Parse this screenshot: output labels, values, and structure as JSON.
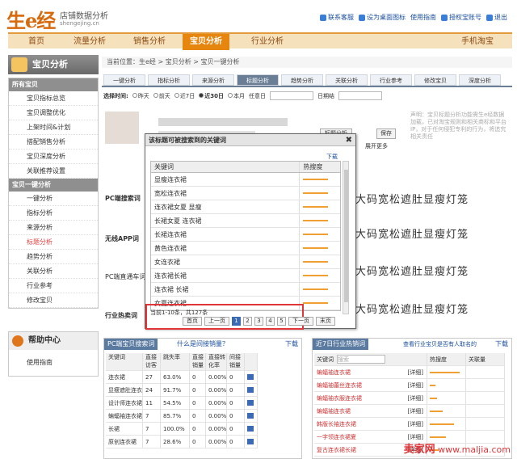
{
  "logo": {
    "text": "生e经",
    "subtitle": "店铺数据分析",
    "domain": "shengejing.cn"
  },
  "toplinks": [
    "联系客服",
    "设为桌面图标",
    "使用指南",
    "授权宝账号",
    "退出"
  ],
  "nav": {
    "tabs": [
      "首页",
      "流量分析",
      "销售分析",
      "宝贝分析",
      "行业分析"
    ],
    "right": "手机淘宝",
    "active": 3
  },
  "sidebar": {
    "title": "宝贝分析",
    "group1": {
      "head": "所有宝贝",
      "items": [
        "宝贝指标总览",
        "宝贝调整优化",
        "上架时间&计划",
        "搭配销售分析",
        "宝贝深度分析",
        "关联推荐设置"
      ]
    },
    "group2": {
      "head": "宝贝一键分析",
      "items": [
        "一键分析",
        "指标分析",
        "来源分析",
        "标题分析",
        "趋势分析",
        "关联分析",
        "行业参考",
        "修改宝贝"
      ]
    }
  },
  "help": {
    "title": "帮助中心",
    "item": "使用指南"
  },
  "breadcrumb": "当前位置：生e经 > 宝贝分析 > 宝贝一键分析",
  "subtabs": [
    "一键分析",
    "指标分析",
    "来源分析",
    "标题分析",
    "趋势分析",
    "关联分析",
    "行业参考",
    "修改宝贝",
    "深度分析"
  ],
  "timebar": {
    "label": "选择时间:",
    "options": [
      "昨天",
      "前天",
      "近7日",
      "近30日",
      "本月"
    ],
    "any": "任意日",
    "to": "日期结"
  },
  "declare": "声明：宝贝标题分析功能​需生e经数据加载，已对​淘宝规则和相关商标和​平台IP，对于任何侵犯专利​的行为，将追究相关责任",
  "buttons": {
    "analyze": "标题分析",
    "save": "保存",
    "expand": "展开更多"
  },
  "rows": [
    {
      "label": "PC端搜索词",
      "text": "大码宽松遮肚显瘦灯笼"
    },
    {
      "label": "无线APP词",
      "text": "大码宽松遮肚显瘦灯笼"
    },
    {
      "label": "PC端直通车词",
      "text": "大码宽松遮肚显瘦灯笼"
    },
    {
      "label": "行业热卖词",
      "text": "大码宽松遮肚显瘦灯笼"
    }
  ],
  "modal": {
    "title": "该标题可被搜索到的关键词",
    "download": "下载",
    "col1": "关键词",
    "col2": "热搜度",
    "rows": [
      {
        "k": "显瘦连衣裙",
        "v": 0.85
      },
      {
        "k": "宽松连衣裙",
        "v": 0.85
      },
      {
        "k": "连衣裙女夏 显瘦",
        "v": 0.85
      },
      {
        "k": "长裙女夏 连衣裙",
        "v": 0.85
      },
      {
        "k": "长裙连衣裙",
        "v": 0.85
      },
      {
        "k": "黄色连衣裙",
        "v": 0.85
      },
      {
        "k": "女连衣裙",
        "v": 0.85
      },
      {
        "k": "连衣裙长裙",
        "v": 0.85
      },
      {
        "k": "连衣裙 长裙",
        "v": 0.85
      },
      {
        "k": "女夏连衣裙",
        "v": 0.85
      }
    ],
    "summary": "当前1-10条，共127条",
    "pager": {
      "first": "首页",
      "prev": "上一页",
      "pages": [
        "1",
        "2",
        "3",
        "4",
        "5"
      ],
      "next": "下一页",
      "last": "末页"
    }
  },
  "left_table": {
    "tag": "PC端宝贝搜索词",
    "link": "什么是间接销量？",
    "download": "下载",
    "headers": [
      "关键词",
      "直接访客",
      "跳失率",
      "直接销量",
      "直接转化率",
      "间接销量"
    ],
    "rows": [
      [
        "连衣裙",
        "27",
        "63.0%",
        "0",
        "0.00%",
        "0"
      ],
      [
        "显瘦遮肚连衣裙",
        "24",
        "91.7%",
        "0",
        "0.00%",
        "0"
      ],
      [
        "设计师连衣裙",
        "11",
        "54.5%",
        "0",
        "0.00%",
        "0"
      ],
      [
        "蝙蝠袖连衣裙",
        "7",
        "85.7%",
        "0",
        "0.00%",
        "0"
      ],
      [
        "长裙",
        "7",
        "100.0%",
        "0",
        "0.00%",
        "0"
      ],
      [
        "原创连衣裙",
        "7",
        "28.6%",
        "0",
        "0.00%",
        "0"
      ]
    ]
  },
  "right_table": {
    "tag": "近7日行业热销词",
    "link": "查看行业宝贝是否有人取名的",
    "download": "下载",
    "search_placeholder": "搜索",
    "headers": [
      "关键词",
      "热搜度",
      "关联量"
    ],
    "rows": [
      [
        "蝙蝠袖连衣裙",
        "[详细]"
      ],
      [
        "蝙蝠袖蕾丝连衣裙",
        "[详细]"
      ],
      [
        "蝙蝠袖衣服连衣裙",
        "[详细]"
      ],
      [
        "蝙蝠袖连衣裙",
        "[详细]"
      ],
      [
        "韩版长袖连衣裙",
        "[详细]"
      ],
      [
        "一字领连衣裙夏",
        "[详细]"
      ],
      [
        "复古连衣裙长裙",
        "[详细]"
      ]
    ]
  },
  "watermark": {
    "brand": "卖家网",
    "url": "www.maljia.com"
  }
}
